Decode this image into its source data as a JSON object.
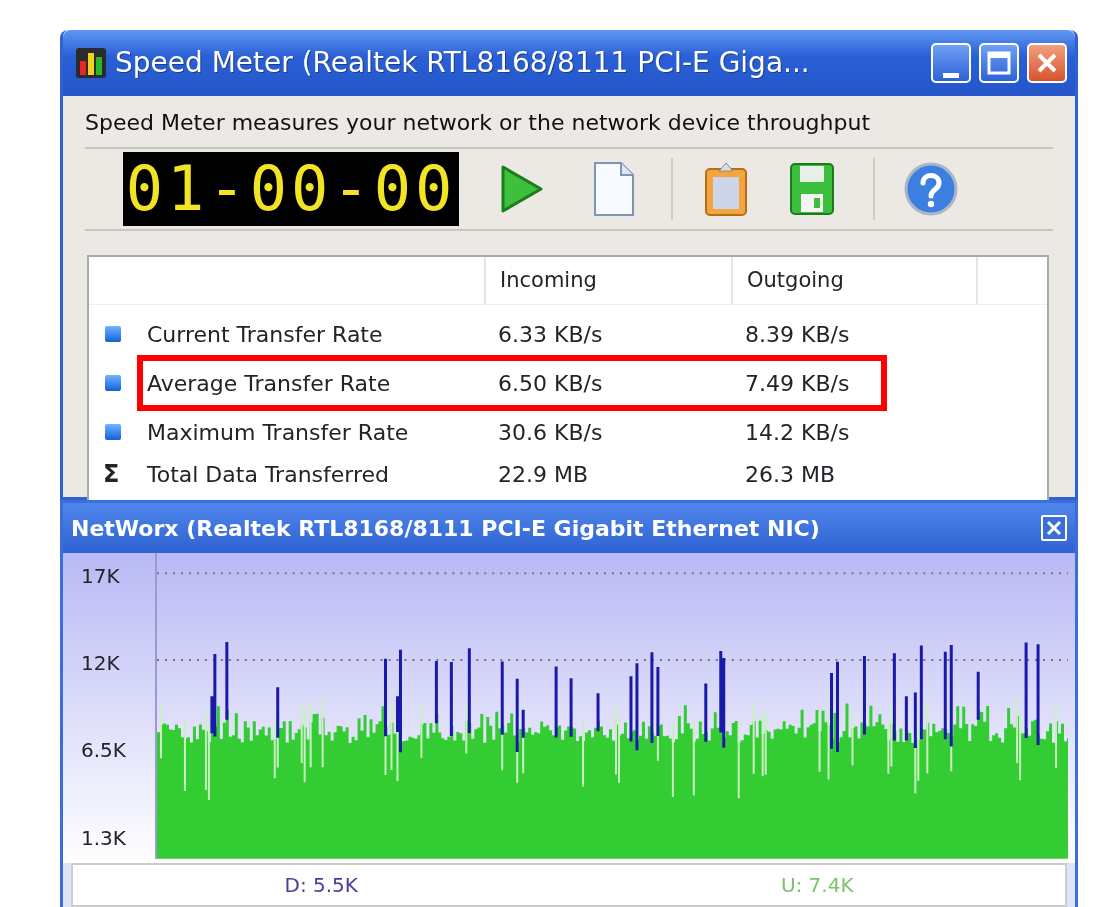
{
  "window": {
    "title": "Speed Meter (Realtek RTL8168/8111 PCI-E Giga..."
  },
  "description": "Speed Meter measures your network or the network device throughput",
  "timer": "01-00-00",
  "table": {
    "columns": [
      "Incoming",
      "Outgoing"
    ],
    "rows": [
      {
        "kind": "rate",
        "label": "Current Transfer Rate",
        "incoming": "6.33 KB/s",
        "outgoing": "8.39 KB/s",
        "highlighted": false
      },
      {
        "kind": "rate",
        "label": "Average Transfer Rate",
        "incoming": "6.50 KB/s",
        "outgoing": "7.49 KB/s",
        "highlighted": true
      },
      {
        "kind": "rate",
        "label": "Maximum Transfer Rate",
        "incoming": "30.6 KB/s",
        "outgoing": "14.2 KB/s",
        "highlighted": false
      },
      {
        "kind": "total",
        "symbol": "Σ",
        "label": "Total Data Transferred",
        "incoming": "22.9 MB",
        "outgoing": "26.3 MB",
        "highlighted": false
      }
    ]
  },
  "graph_window": {
    "title": "NetWorx (Realtek RTL8168/8111 PCI-E Gigabit Ethernet NIC)",
    "y_labels": [
      "17K",
      "12K",
      "6.5K",
      "1.3K"
    ],
    "download": "D: 5.5K",
    "upload": "U: 7.4K"
  }
}
